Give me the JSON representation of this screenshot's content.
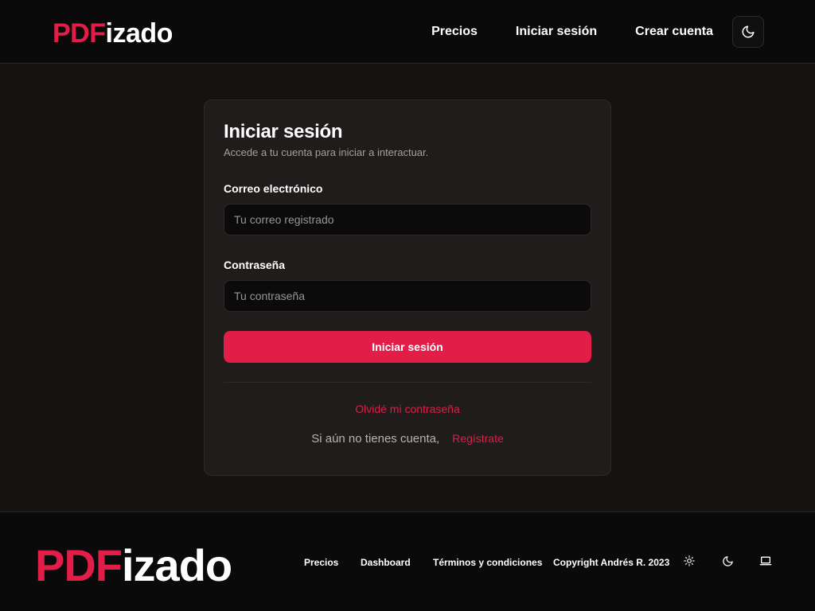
{
  "header": {
    "logo_pdf": "PDF",
    "logo_rest": "izado",
    "nav": [
      "Precios",
      "Iniciar sesión",
      "Crear cuenta"
    ],
    "theme_icon": "moon-icon"
  },
  "login": {
    "title": "Iniciar sesión",
    "subtitle": "Accede a tu cuenta para iniciar a interactuar.",
    "email_label": "Correo electrónico",
    "email_placeholder": "Tu correo registrado",
    "email_value": "",
    "password_label": "Contraseña",
    "password_placeholder": "Tu contraseña",
    "password_value": "",
    "submit_label": "Iniciar sesión",
    "forgot_label": "Olvidé mi contraseña",
    "signup_text": "Si aún no tienes cuenta,",
    "signup_link": "Regístrate"
  },
  "footer": {
    "logo_pdf": "PDF",
    "logo_rest": "izado",
    "links": [
      "Precios",
      "Dashboard",
      "Términos y condiciones"
    ],
    "copyright": "Copyright Andrés R. 2023",
    "theme_icons": [
      "sun-icon",
      "moon-icon",
      "laptop-icon"
    ]
  },
  "colors": {
    "accent": "#e11d48",
    "background": "#151312",
    "card": "#1f1c1b",
    "header": "#0b0a0a"
  }
}
